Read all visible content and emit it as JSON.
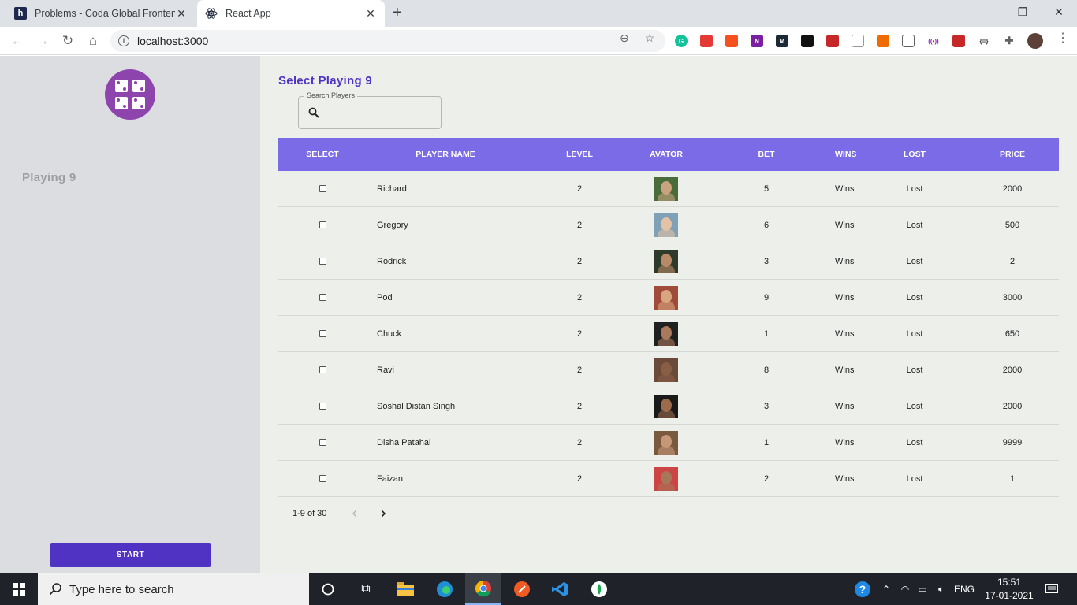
{
  "browser": {
    "tabs": [
      {
        "title": "Problems - Coda Global Frontend",
        "favicon": "h",
        "active": false
      },
      {
        "title": "React App",
        "favicon": "react-icon",
        "active": true
      }
    ],
    "address": "localhost:3000"
  },
  "sidebar": {
    "heading": "Playing 9",
    "start_label": "START"
  },
  "main": {
    "title": "Select Playing 9",
    "search": {
      "label": "Search Players",
      "value": ""
    },
    "columns": [
      "SELECT",
      "PLAYER NAME",
      "LEVEL",
      "AVATOR",
      "BET",
      "WINS",
      "LOST",
      "PRICE"
    ],
    "rows": [
      {
        "name": "Richard",
        "level": "2",
        "bet": "5",
        "wins": "Wins",
        "lost": "Lost",
        "price": "2000",
        "selected": false
      },
      {
        "name": "Gregory",
        "level": "2",
        "bet": "6",
        "wins": "Wins",
        "lost": "Lost",
        "price": "500",
        "selected": false
      },
      {
        "name": "Rodrick",
        "level": "2",
        "bet": "3",
        "wins": "Wins",
        "lost": "Lost",
        "price": "2",
        "selected": false
      },
      {
        "name": "Pod",
        "level": "2",
        "bet": "9",
        "wins": "Wins",
        "lost": "Lost",
        "price": "3000",
        "selected": false
      },
      {
        "name": "Chuck",
        "level": "2",
        "bet": "1",
        "wins": "Wins",
        "lost": "Lost",
        "price": "650",
        "selected": false
      },
      {
        "name": "Ravi",
        "level": "2",
        "bet": "8",
        "wins": "Wins",
        "lost": "Lost",
        "price": "2000",
        "selected": false
      },
      {
        "name": "Soshal Distan Singh",
        "level": "2",
        "bet": "3",
        "wins": "Wins",
        "lost": "Lost",
        "price": "2000",
        "selected": false
      },
      {
        "name": "Disha Patahai",
        "level": "2",
        "bet": "1",
        "wins": "Wins",
        "lost": "Lost",
        "price": "9999",
        "selected": false
      },
      {
        "name": "Faizan",
        "level": "2",
        "bet": "2",
        "wins": "Wins",
        "lost": "Lost",
        "price": "1",
        "selected": false
      }
    ],
    "pagination": "1-9 of 30"
  },
  "taskbar": {
    "search_placeholder": "Type here to search",
    "language": "ENG",
    "time": "15:51",
    "date": "17-01-2021"
  },
  "colors": {
    "accent": "#5133c4",
    "table_header": "#7b6be6",
    "logo": "#8e44ad",
    "sidebar_bg": "#dcdde1",
    "main_bg": "#ecefea"
  }
}
